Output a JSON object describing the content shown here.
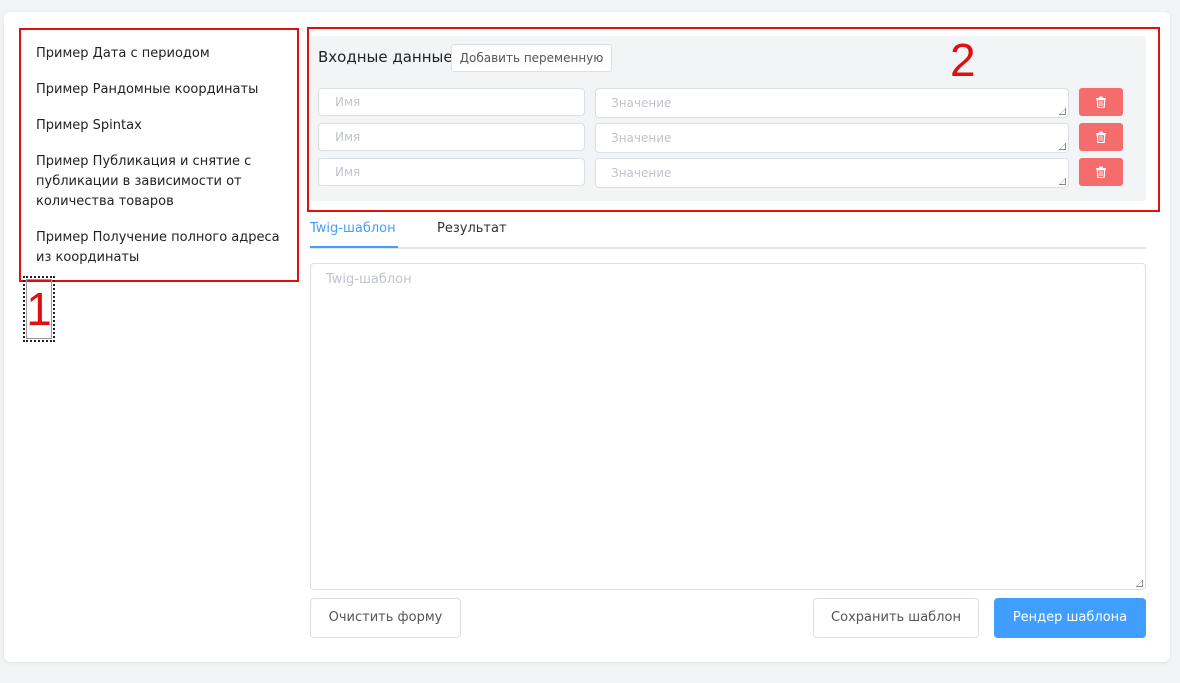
{
  "examples": [
    {
      "label": "Пример Дата с периодом"
    },
    {
      "label": "Пример Рандомные координаты"
    },
    {
      "label": "Пример Spintax"
    },
    {
      "label": "Пример Публикация и снятие с публикации в зависимости от количества товаров"
    },
    {
      "label": "Пример Получение полного адреса из координаты"
    }
  ],
  "annotations": {
    "box1": "1",
    "box2": "2",
    "color": "#e01010"
  },
  "variables": {
    "title": "Входные данные",
    "add_label": "Добавить переменную",
    "rows": [
      {
        "name_placeholder": "Имя",
        "value_placeholder": "Значение"
      },
      {
        "name_placeholder": "Имя",
        "value_placeholder": "Значение"
      },
      {
        "name_placeholder": "Имя",
        "value_placeholder": "Значение"
      }
    ],
    "delete_icon": "trash-icon",
    "delete_color": "#f56c6c"
  },
  "tabs": [
    {
      "label": "Twig-шаблон",
      "active": true
    },
    {
      "label": "Результат",
      "active": false
    }
  ],
  "template": {
    "placeholder": "Twig-шаблон"
  },
  "buttons": {
    "clear": "Очистить форму",
    "save": "Сохранить шаблон",
    "render": "Рендер шаблона"
  },
  "colors": {
    "accent": "#409eff"
  }
}
